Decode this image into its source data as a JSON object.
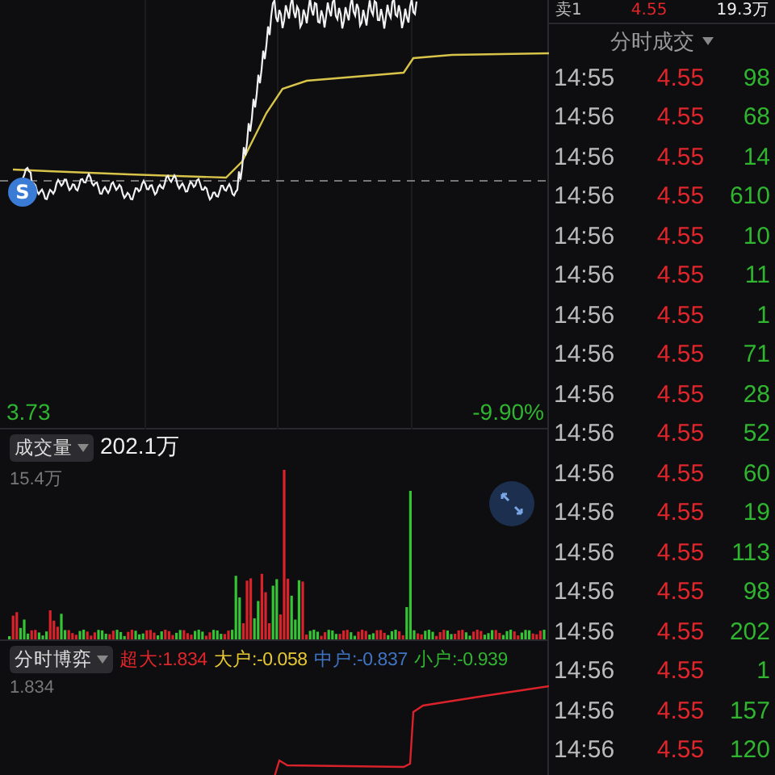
{
  "quote_row": {
    "label": "卖1",
    "price": "4.55",
    "volume": "19.3万"
  },
  "price_chart": {
    "marker": "S",
    "low_price": "3.73",
    "low_change": "-9.90%"
  },
  "volume_panel": {
    "selector": "成交量",
    "total": "202.1万",
    "max_label": "15.4万"
  },
  "flow_panel": {
    "selector": "分时博弈",
    "max_label": "1.834",
    "items": [
      {
        "label": "超大:1.834",
        "color": "#e0252b"
      },
      {
        "label": "大户:-0.058",
        "color": "#e6c832"
      },
      {
        "label": "中户:-0.837",
        "color": "#3f74c4"
      },
      {
        "label": "小户:-0.939",
        "color": "#2fb52f"
      }
    ]
  },
  "trades": {
    "title": "分时成交",
    "rows": [
      {
        "time": "14:55",
        "price": "4.55",
        "volume": "98"
      },
      {
        "time": "14:56",
        "price": "4.55",
        "volume": "68"
      },
      {
        "time": "14:56",
        "price": "4.55",
        "volume": "14"
      },
      {
        "time": "14:56",
        "price": "4.55",
        "volume": "610"
      },
      {
        "time": "14:56",
        "price": "4.55",
        "volume": "10"
      },
      {
        "time": "14:56",
        "price": "4.55",
        "volume": "11"
      },
      {
        "time": "14:56",
        "price": "4.55",
        "volume": "1"
      },
      {
        "time": "14:56",
        "price": "4.55",
        "volume": "71"
      },
      {
        "time": "14:56",
        "price": "4.55",
        "volume": "28"
      },
      {
        "time": "14:56",
        "price": "4.55",
        "volume": "52"
      },
      {
        "time": "14:56",
        "price": "4.55",
        "volume": "60"
      },
      {
        "time": "14:56",
        "price": "4.55",
        "volume": "19"
      },
      {
        "time": "14:56",
        "price": "4.55",
        "volume": "113"
      },
      {
        "time": "14:56",
        "price": "4.55",
        "volume": "98"
      },
      {
        "time": "14:56",
        "price": "4.55",
        "volume": "202"
      },
      {
        "time": "14:56",
        "price": "4.55",
        "volume": "1"
      },
      {
        "time": "14:56",
        "price": "4.55",
        "volume": "157"
      },
      {
        "time": "14:56",
        "price": "4.55",
        "volume": "120"
      }
    ]
  }
}
